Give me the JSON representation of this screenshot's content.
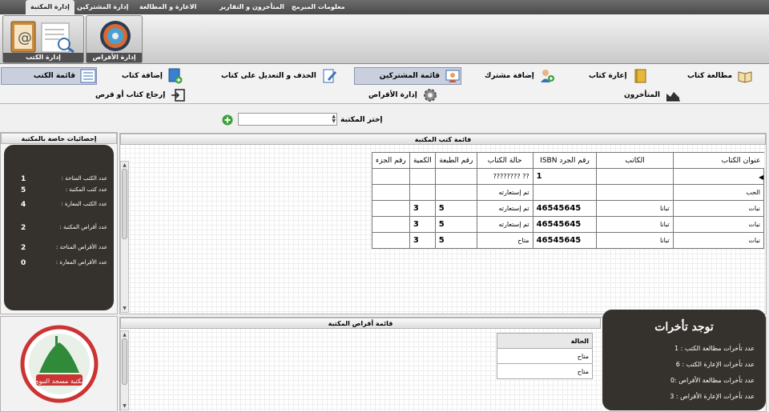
{
  "menu": {
    "items": [
      "إدارة المكتبة",
      "إدارة المشتركين",
      "الاعارة و المطالعة",
      "المتأخرون و التقارير",
      "معلومات المبرمج"
    ]
  },
  "ribbon": {
    "books_label": "إدارة الكتب",
    "disks_label": "إدارة الأقراص"
  },
  "toolbar": {
    "read_book": "مطالعة كتاب",
    "lend_book": "إعارة كتاب",
    "add_subscriber": "إضافة مشترك",
    "subscribers_list": "قائمة المشتركين",
    "edit_book": "الحذف و التعديل على كتاب",
    "add_book": "إضافة كتاب",
    "books_list": "قائمة الكتب",
    "late": "المتأخرون",
    "manage_disks": "إدارة الأقراص",
    "return_book": "إرجاع كتاب أو قرص"
  },
  "selector": {
    "label": "إختر المكتبة",
    "value": ""
  },
  "stats": {
    "title": "إحصائيات خاصة بالمكتبة",
    "rows": [
      {
        "label": "عدد الكتب المتاحة :",
        "value": "1"
      },
      {
        "label": "عدد كتب المكتبة :",
        "value": "5"
      },
      {
        "label": "عدد الكتب المعارة :",
        "value": "4"
      },
      {
        "label": "عدد أقراص المكتبة :",
        "value": "2"
      },
      {
        "label": "عدد الأقراص المتاحة :",
        "value": "2"
      },
      {
        "label": "عدد الأقراص المعارة :",
        "value": "0"
      }
    ]
  },
  "books": {
    "title": "قائمة كتب المكتبة",
    "headers": [
      "عنوان الكتاب",
      "الكاتب",
      "رقم الجرد ISBN",
      "حالة الكتاب",
      "رقم الطبعة",
      "الكمية",
      "رقم الجزء"
    ],
    "rows": [
      [
        "",
        "",
        "1",
        "?? ????????",
        "",
        "",
        ""
      ],
      [
        "الحب",
        "",
        "",
        "تم إستعارته",
        "",
        "",
        ""
      ],
      [
        "نبات",
        "تبانا",
        "46545645",
        "تم إستعارته",
        "5",
        "3",
        ""
      ],
      [
        "نبات",
        "تبانا",
        "46545645",
        "تم إستعارته",
        "5",
        "3",
        ""
      ],
      [
        "نبات",
        "تبانا",
        "46545645",
        "متاح",
        "5",
        "3",
        ""
      ]
    ]
  },
  "disks": {
    "title": "قائمة أقراص المكتبة",
    "header": "الحالة",
    "rows": [
      "متاح",
      "متاح"
    ]
  },
  "delays": {
    "title": "توجد تأخرات",
    "lines": [
      "عدد تأخرات مطالعة الكتب : 1",
      "عدد تأخرات الإعارة الكتب : 6",
      "عدد تأخرات مطالعة الأقراص :0",
      "عدد تأخرات الإعارة الأقراص : 3"
    ]
  },
  "logo": {
    "caption": "مكتبة مسجد النبوي"
  },
  "colors": {
    "dark_panel": "#35312c",
    "selected_tool": "#c9cfdd",
    "menubar": "#4a4a4a"
  }
}
